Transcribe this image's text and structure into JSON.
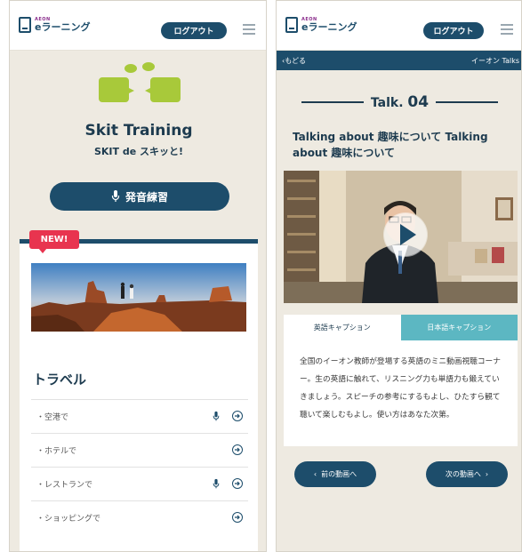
{
  "left": {
    "header": {
      "logo_brand": "AEON",
      "logo_name": "eラーニング",
      "logout_label": "ログアウト"
    },
    "hero": {
      "title": "Skit Training",
      "subtitle": "SKIT de スキッと!"
    },
    "pronunciation_button_label": "発音練習",
    "new_badge": "NEW!",
    "section_title": "トラベル",
    "items": [
      {
        "label": "・空港で",
        "has_mic": true
      },
      {
        "label": "・ホテルで",
        "has_mic": false
      },
      {
        "label": "・レストランで",
        "has_mic": true
      },
      {
        "label": "・ショッピングで",
        "has_mic": false
      }
    ]
  },
  "right": {
    "header": {
      "logo_brand": "AEON",
      "logo_name": "eラーニング",
      "logout_label": "ログアウト"
    },
    "nav": {
      "back_label": "‹もどる",
      "section_label": "イーオン Talks"
    },
    "talk": {
      "label": "Talk.",
      "number": "04",
      "title": "Talking about 趣味について Talking about 趣味について"
    },
    "tabs": [
      {
        "label": "英語キャプション"
      },
      {
        "label": "日本語キャプション"
      }
    ],
    "caption": "全国のイーオン教師が登場する英語のミニ動画視聴コーナー。生の英語に触れて、リスニング力も単語力も鍛えていきましょう。スピーチの参考にするもよし、ひたすら観て聴いて楽しむもよし。使い方はあなた次第。",
    "prev_label": "前の動画へ",
    "next_label": "次の動画へ"
  },
  "colors": {
    "navy": "#1d4d6b",
    "teal": "#5cb7c2",
    "red": "#e8344f",
    "green": "#a8c93a",
    "background": "#eeeae1"
  }
}
